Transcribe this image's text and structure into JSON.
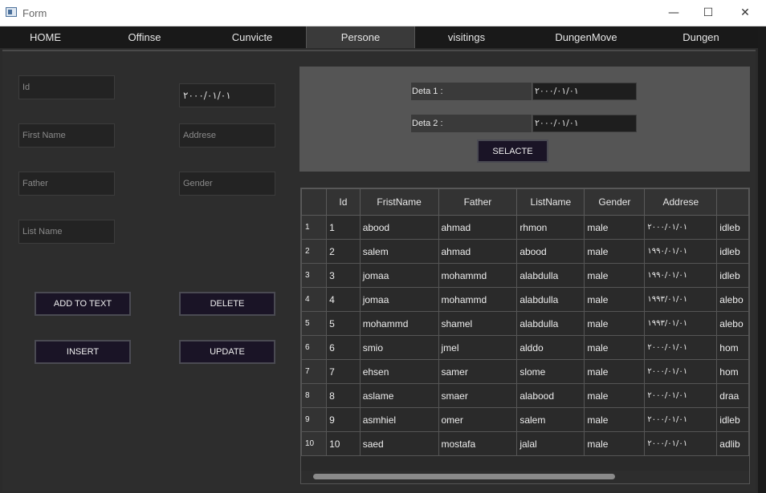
{
  "window": {
    "title": "Form",
    "minimize": "—",
    "maximize": "☐",
    "close": "✕"
  },
  "tabs": [
    "HOME",
    "Offinse",
    "Cunvicte",
    "Persone",
    "visitings",
    "DungenMove",
    "Dungen"
  ],
  "active_tab": "Persone",
  "form": {
    "id_placeholder": "Id",
    "first_name_placeholder": "First Name",
    "father_placeholder": "Father",
    "list_name_placeholder": "List Name",
    "date_value": "۲۰۰۰/۰۱/۰۱",
    "address_placeholder": "Addrese",
    "gender_placeholder": "Gender"
  },
  "buttons": {
    "add_to_text": "ADD TO TEXT",
    "delete": "DELETE",
    "insert": "INSERT",
    "update": "UPDATE"
  },
  "filter": {
    "date1_label": "Deta 1 :",
    "date1_value": "۲۰۰۰/۰۱/۰۱",
    "date2_label": "Deta 2 :",
    "date2_value": "۲۰۰۰/۰۱/۰۱",
    "select_button": "SELACTE"
  },
  "grid": {
    "columns": [
      "Id",
      "FristName",
      "Father",
      "ListName",
      "Gender",
      "Addrese",
      ""
    ],
    "rows": [
      {
        "n": "1",
        "id": "1",
        "first": "abood",
        "father": "ahmad",
        "list": "rhmon",
        "gender": "male",
        "date": "۲۰۰۰/۰۱/۰۱",
        "addr": "idleb"
      },
      {
        "n": "2",
        "id": "2",
        "first": "salem",
        "father": "ahmad",
        "list": "abood",
        "gender": "male",
        "date": "۱۹۹۰/۰۱/۰۱",
        "addr": "idleb"
      },
      {
        "n": "3",
        "id": "3",
        "first": "jomaa",
        "father": "mohammd",
        "list": "alabdulla",
        "gender": "male",
        "date": "۱۹۹۰/۰۱/۰۱",
        "addr": "idleb"
      },
      {
        "n": "4",
        "id": "4",
        "first": "jomaa",
        "father": "mohammd",
        "list": "alabdulla",
        "gender": "male",
        "date": "۱۹۹۳/۰۱/۰۱",
        "addr": "alebo"
      },
      {
        "n": "5",
        "id": "5",
        "first": "mohammd",
        "father": "shamel",
        "list": "alabdulla",
        "gender": "male",
        "date": "۱۹۹۳/۰۱/۰۱",
        "addr": "alebo"
      },
      {
        "n": "6",
        "id": "6",
        "first": "smio",
        "father": "jmel",
        "list": "alddo",
        "gender": "male",
        "date": "۲۰۰۰/۰۱/۰۱",
        "addr": "hom"
      },
      {
        "n": "7",
        "id": "7",
        "first": "ehsen",
        "father": "samer",
        "list": "slome",
        "gender": "male",
        "date": "۲۰۰۰/۰۱/۰۱",
        "addr": "hom"
      },
      {
        "n": "8",
        "id": "8",
        "first": "aslame",
        "father": "smaer",
        "list": "alabood",
        "gender": "male",
        "date": "۲۰۰۰/۰۱/۰۱",
        "addr": "draa"
      },
      {
        "n": "9",
        "id": "9",
        "first": "asmhiel",
        "father": "omer",
        "list": "salem",
        "gender": "male",
        "date": "۲۰۰۰/۰۱/۰۱",
        "addr": "idleb"
      },
      {
        "n": "10",
        "id": "10",
        "first": "saed",
        "father": "mostafa",
        "list": "jalal",
        "gender": "male",
        "date": "۲۰۰۰/۰۱/۰۱",
        "addr": "adlib"
      }
    ]
  }
}
